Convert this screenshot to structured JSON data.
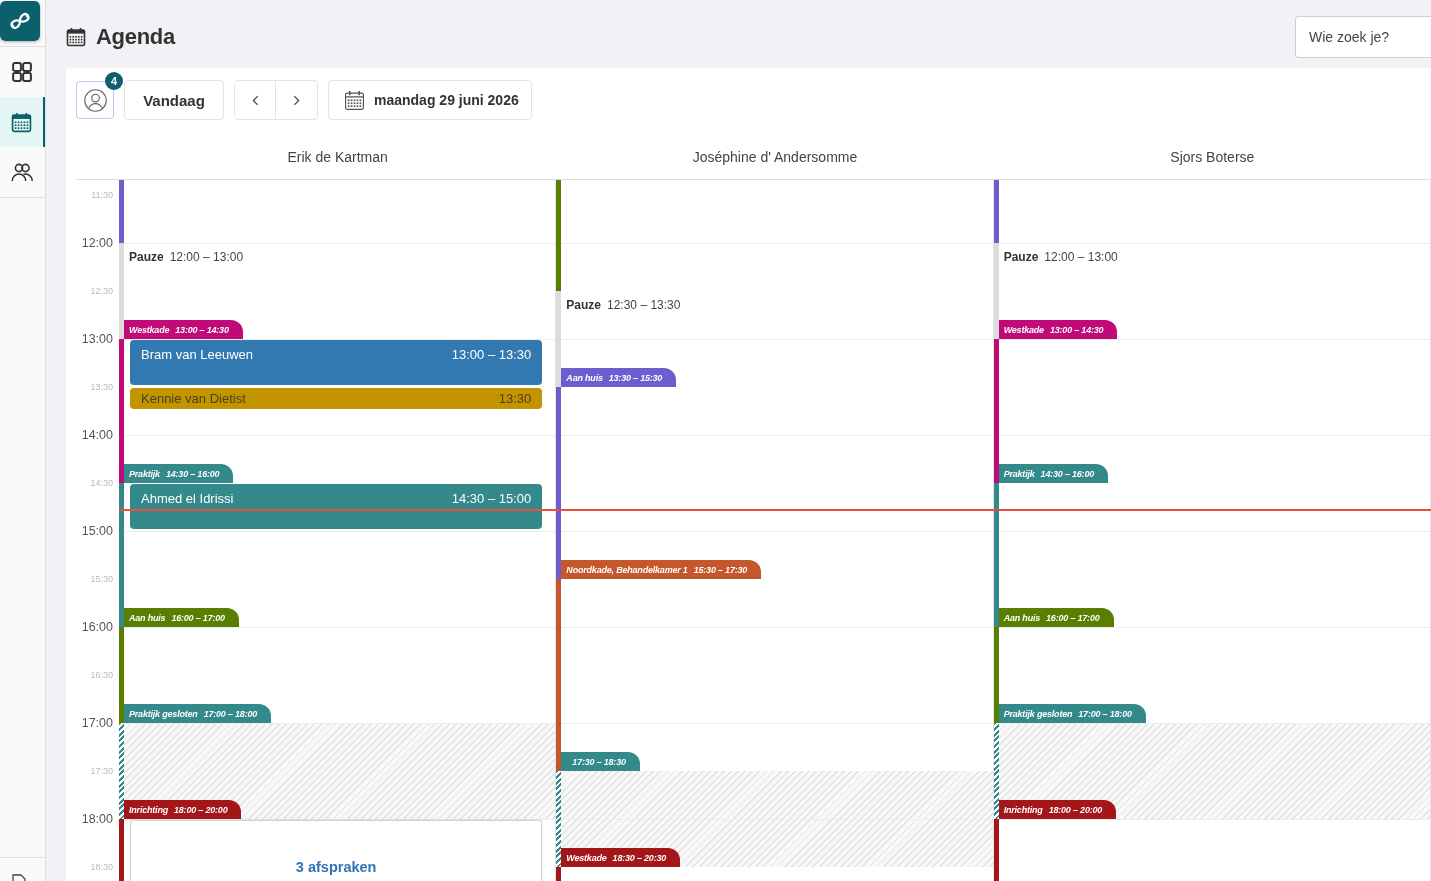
{
  "sidebar": {
    "items": [
      {
        "kind": "dashboard",
        "selected": false
      },
      {
        "kind": "calendar",
        "selected": true
      },
      {
        "kind": "people",
        "selected": false
      }
    ]
  },
  "header": {
    "title": "Agenda",
    "search": {
      "placeholder": "Wie zoek je?"
    }
  },
  "toolbar": {
    "filter_count": "4",
    "today": "Vandaag",
    "date": "maandag 29 juni 2026"
  },
  "calendar": {
    "time_labels": [
      {
        "text": "11:30",
        "kind": "half"
      },
      {
        "text": "12:00",
        "kind": "hour"
      },
      {
        "text": "12:30",
        "kind": "half"
      },
      {
        "text": "13:00",
        "kind": "hour"
      },
      {
        "text": "13:30",
        "kind": "half"
      },
      {
        "text": "14:00",
        "kind": "hour"
      },
      {
        "text": "14:30",
        "kind": "half"
      },
      {
        "text": "15:00",
        "kind": "hour"
      },
      {
        "text": "15:30",
        "kind": "half"
      },
      {
        "text": "16:00",
        "kind": "hour"
      },
      {
        "text": "16:30",
        "kind": "half"
      },
      {
        "text": "17:00",
        "kind": "hour"
      },
      {
        "text": "17:30",
        "kind": "half"
      },
      {
        "text": "18:00",
        "kind": "hour"
      },
      {
        "text": "18:30",
        "kind": "half"
      }
    ],
    "columns": [
      {
        "name": "Erik de Kartman",
        "blocks": [
          {
            "kind": "work",
            "color": "#6b5fcf"
          },
          {
            "kind": "pause",
            "title": "Pauze",
            "time": "12:00 – 13:00"
          },
          {
            "kind": "work",
            "label": "Westkade",
            "time": "13:00 – 14:30",
            "color": "#bf0a78",
            "appointments": [
              {
                "kind": "appointment",
                "name": "Bram van Leeuwen",
                "time": "13:00 – 13:30",
                "color": "#3278b1"
              },
              {
                "kind": "short",
                "name": "Kennie van Dietist",
                "time": "13:30",
                "color": "#c29400"
              }
            ]
          },
          {
            "kind": "work",
            "label": "Praktijk",
            "time": "14:30 – 16:00",
            "color": "#34898b",
            "appointments": [
              {
                "kind": "appointment",
                "name": "Ahmed el Idrissi",
                "time": "14:30 – 15:00",
                "color": "#34898b"
              }
            ]
          },
          {
            "kind": "work",
            "label": "Aan huis",
            "time": "16:00 – 17:00",
            "color": "#5a7e00"
          },
          {
            "kind": "closed",
            "label": "Praktijk gesloten",
            "time": "17:00 – 18:00",
            "color": "#34898b"
          },
          {
            "kind": "work",
            "label": "Inrichting",
            "time": "18:00 – 20:00",
            "color": "#a3161a",
            "appointments": [
              {
                "kind": "summary",
                "text": "3 afspraken"
              }
            ]
          }
        ]
      },
      {
        "name": "Joséphine d' Andersomme",
        "blocks": [
          {
            "kind": "work",
            "color": "#5a7e00"
          },
          {
            "kind": "pause",
            "title": "Pauze",
            "time": "12:30 – 13:30"
          },
          {
            "kind": "work",
            "label": "Aan huis",
            "time": "13:30 – 15:30",
            "color": "#6b5fcf"
          },
          {
            "kind": "work",
            "label": "Noordkade, Behandelkamer 1",
            "time": "15:30 – 17:30",
            "color": "#c4582c"
          },
          {
            "kind": "closed",
            "time": "17:30 – 18:30",
            "color": "#34898b"
          },
          {
            "kind": "work",
            "label": "Westkade",
            "time": "18:30 – 20:30",
            "color": "#a3161a"
          }
        ]
      },
      {
        "name": "Sjors Boterse",
        "blocks": [
          {
            "kind": "work",
            "color": "#6b5fcf"
          },
          {
            "kind": "pause",
            "title": "Pauze",
            "time": "12:00 – 13:00"
          },
          {
            "kind": "work",
            "label": "Westkade",
            "time": "13:00 – 14:30",
            "color": "#bf0a78"
          },
          {
            "kind": "work",
            "label": "Praktijk",
            "time": "14:30 – 16:00",
            "color": "#34898b"
          },
          {
            "kind": "work",
            "label": "Aan huis",
            "time": "16:00 – 17:00",
            "color": "#5a7e00"
          },
          {
            "kind": "closed",
            "label": "Praktijk gesloten",
            "time": "17:00 – 18:00",
            "color": "#34898b"
          },
          {
            "kind": "work",
            "label": "Inrichting",
            "time": "18:00 – 20:00",
            "color": "#a3161a"
          }
        ]
      }
    ]
  }
}
